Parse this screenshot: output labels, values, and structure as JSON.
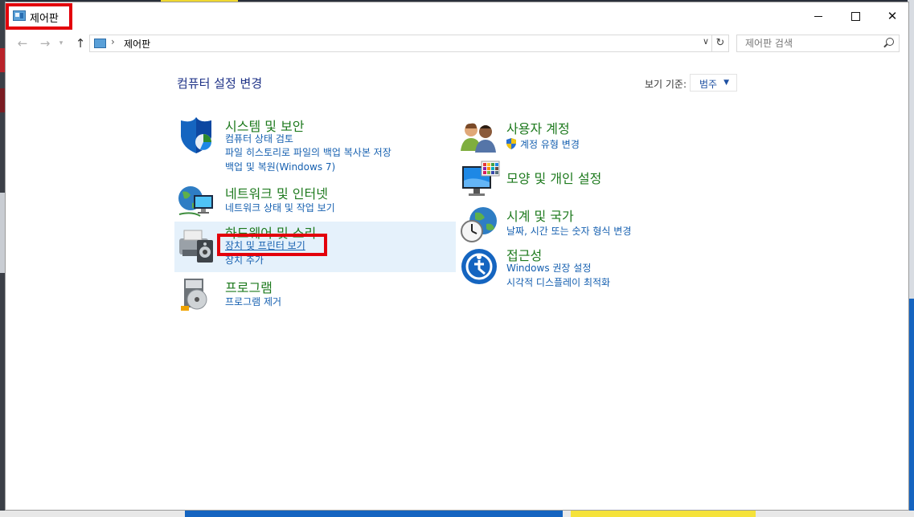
{
  "window": {
    "title": "제어판",
    "minimize_glyph": "",
    "close_glyph": "✕"
  },
  "nav": {
    "back_glyph": "←",
    "forward_glyph": "→",
    "recent_glyph": "▾",
    "up_glyph": "↑",
    "address_separator": "›",
    "address_path": "제어판",
    "address_dropdown_glyph": "∨",
    "refresh_glyph": "↻",
    "search_placeholder": "제어판 검색"
  },
  "main": {
    "heading": "컴퓨터 설정 변경",
    "view_by_label": "보기 기준:",
    "view_by_value": "범주",
    "view_by_caret": "▼"
  },
  "categories": [
    {
      "title": "시스템 및 보안",
      "icon": "shield-icon",
      "links": [
        "컴퓨터 상태 검토",
        "파일 히스토리로 파일의 백업 복사본 저장",
        "백업 및 복원(Windows 7)"
      ]
    },
    {
      "title": "네트워크 및 인터넷",
      "icon": "network-globe-icon",
      "links": [
        "네트워크 상태 및 작업 보기"
      ]
    },
    {
      "title": "하드웨어 및 소리",
      "icon": "printer-speaker-icon",
      "links": [
        "장치 및 프린터 보기",
        "장치 추가"
      ]
    },
    {
      "title": "프로그램",
      "icon": "program-disc-icon",
      "links": [
        "프로그램 제거"
      ]
    },
    {
      "title": "사용자 계정",
      "icon": "users-icon",
      "links": [
        "계정 유형 변경"
      ]
    },
    {
      "title": "모양 및 개인 설정",
      "icon": "monitor-palette-icon",
      "links": []
    },
    {
      "title": "시계 및 국가",
      "icon": "clock-globe-icon",
      "links": [
        "날짜, 시간 또는 숫자 형식 변경"
      ]
    },
    {
      "title": "접근성",
      "icon": "accessibility-icon",
      "links": [
        "Windows 권장 설정",
        "시각적 디스플레이 최적화"
      ]
    }
  ],
  "colors": {
    "category_title": "#1e7a1e",
    "link": "#1660b0",
    "heading": "#1e3287",
    "highlight_box": "#e3000b",
    "hover_background": "#e5f1fb"
  }
}
